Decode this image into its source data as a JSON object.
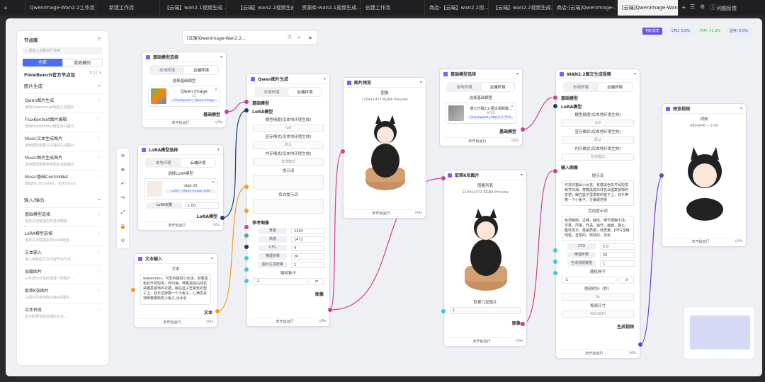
{
  "tabs": [
    {
      "label": "QwenImage-Wan2.2工作流"
    },
    {
      "label": "新建工作流"
    },
    {
      "label": "【云端】wan2.1视频生成..."
    },
    {
      "label": "【云端】wan2.2视频生成"
    },
    {
      "label": "资源库-wan2.1视频生成..."
    },
    {
      "label": "创建工作流"
    },
    {
      "label": "商店-【云端】wan2.2视..."
    },
    {
      "label": "【云端】wan2.2视频生成..."
    },
    {
      "label": "商店-[云端]QwenImage-..."
    },
    {
      "label": "[云端]QwenImage-Wan2..."
    }
  ],
  "topbar": {
    "feedback": "问题反馈"
  },
  "workflow_title": "[云端]QwenImage-Wan2.2...",
  "status": {
    "mode": "初始状态",
    "cpu": "CPU: 0.0%",
    "mem": "内存: 71.3%",
    "gpu": "显存: 0.0%"
  },
  "sidebar": {
    "title": "节点库",
    "search_placeholder": "请输入名称进行搜索",
    "tab_all": "全部",
    "tab_fav": "我收藏的",
    "pack": "FlowBench官方节点包",
    "pack_ver": "0.11 ∨",
    "groups": [
      {
        "name": "图片生成",
        "items": [
          {
            "title": "Qwen图片生成",
            "desc": "使用Qwenimage模型生成图片"
          },
          {
            "title": "FluxKontext图片编辑",
            "desc": "使用FluxKontext模型进行图片..."
          },
          {
            "title": "Music文本生成图片",
            "desc": "使用模型根据文本描述生成图片..."
          },
          {
            "title": "Music图片生成图片",
            "desc": "使用模型根据参考图生成新图片..."
          },
          {
            "title": "Music基础ControlNet",
            "desc": "基础的ControlNet，包含canny..."
          }
        ]
      },
      {
        "name": "输入/输出",
        "items": [
          {
            "title": "基础模型选择",
            "desc": "选择并加载指定的基础模型..."
          },
          {
            "title": "LoRA模型选择",
            "desc": "选择并加载指定的LoRA模型..."
          },
          {
            "title": "文本输入",
            "desc": "输入或粘贴文本内容作为节点..."
          },
          {
            "title": "加载图片",
            "desc": "从本地文件系统选择一张图片..."
          },
          {
            "title": "取第K张图片",
            "desc": "从图片列表中取出第K张图片..."
          },
          {
            "title": "文本预览",
            "desc": "显示和预览经处理的文本..."
          }
        ]
      }
    ]
  },
  "common": {
    "local": "本地环境",
    "cloud": "云端环境",
    "run": "未开始运行",
    "time": "0s"
  },
  "node_base1": {
    "title": "基础模型选择",
    "select": "选择基础模型",
    "model": "Qwen Image",
    "ver": "v1",
    "tag": "Checkpoint | Qwen Image",
    "out": "基础模型"
  },
  "node_lora": {
    "title": "LoRA模型选择",
    "select": "选择LoRA模型",
    "model": "nkpt-15",
    "tag": "LoRA | Qwen Image 20B",
    "weight_k": "LoRA权重",
    "weight_v": "1.00",
    "out": "LoRA模型"
  },
  "node_text": {
    "title": "文本输入",
    "label": "文本",
    "content": "watercolor。可爱的猫耳小女孩。有着黑色的齐耳短发。乔刘海。穿着黑底白线花朵图案装饰的衣裙，躺在篮子里柔软的垫子上。双手还捧着一个小兔子。心满意足地眯着眼睛吃小兔子,淡水彩",
    "out": "文本"
  },
  "node_qwen": {
    "title": "Qwen图片生成",
    "in_base": "基础模型",
    "in_lora": "LoRA模型",
    "prec_label": "模型精度(仅本地环境生效)",
    "prec_val": "fp8",
    "vram_label": "显存模式(仅本地环境生效)",
    "vram_val": "默认",
    "mem_label": "内存模式(仅本地环境生效)",
    "mem_val": "普通模式",
    "prompt": "提示词",
    "neg": "负向提示词",
    "ref": "参考图像",
    "params": [
      {
        "k": "宽度",
        "v": "1104"
      },
      {
        "k": "高度",
        "v": "1472"
      },
      {
        "k": "CFG",
        "v": "4"
      },
      {
        "k": "推理步数",
        "v": "20"
      },
      {
        "k": "图片生成数量",
        "v": "1"
      }
    ],
    "seed_label": "随机种子",
    "seed": "-1",
    "out": "图像"
  },
  "node_preview1": {
    "title": "图片预览",
    "label": "图像",
    "info": "1104x1472 RGBA Preview"
  },
  "node_base2": {
    "title": "基础模型选择",
    "select": "选择基础模型",
    "model": "通义万相2.2-图文视频模...",
    "ver": "bf16",
    "tag": "Checkpoint | Wan2.2 TI2V",
    "out": "基础模型"
  },
  "node_pickk": {
    "title": "取第K张图片",
    "label": "图像列表",
    "info": "1104x1472 RGBA Preview",
    "k_label": "取第几张图片",
    "k_val": "1",
    "out": "图像"
  },
  "node_wan": {
    "title": "WAN2.2图文生成视频",
    "in_base": "基础模型",
    "in_lora": "LoRA模型",
    "prec_label": "模型精度(仅本地环境生效)",
    "prec_val": "fp8",
    "vram_label": "显存模式(仅本地环境生效)",
    "vram_val": "默认",
    "mem_label": "内存模式(仅本地环境生效)",
    "mem_val": "普通模式",
    "in_img": "输入图像",
    "prompt": "提示词",
    "prompt_text": "可爱的猫耳小女孩。有着黑色的齐耳短发和齐刘海。穿着黑底白线花朵图案装饰的衣裙，躺在篮子里柔软的垫子上，双手捧着一个小兔子，正缓缓地将",
    "neg": "负向提示词",
    "neg_text": "色调艳丽，过曝，静态，细节模糊不清，字幕，风格，作品，画作，画面，静止，整体发灰，最差质量，低质量，JPEG压缩残留，丑陋的，残缺的，多余",
    "params": [
      {
        "k": "CFG",
        "v": "5.0"
      },
      {
        "k": "推理步数",
        "v": "50"
      },
      {
        "k": "生成视频数量",
        "v": "1"
      }
    ],
    "seed_label": "随机种子",
    "seed": "-1",
    "dur_label": "视频时长（秒）",
    "dur_val": "0s",
    "size_label": "视频尺寸",
    "size_val": "480x640",
    "out": "生成视频"
  },
  "node_video": {
    "title": "预览视频",
    "label": "视频",
    "info": "480x640 • 0:05"
  },
  "colors": {
    "accent": "#7b5cff",
    "pink": "#d23e8f",
    "navy": "#1e3a6e",
    "orange": "#f0a020",
    "cyan": "#3fc7d6",
    "purple": "#6a3fd0"
  }
}
